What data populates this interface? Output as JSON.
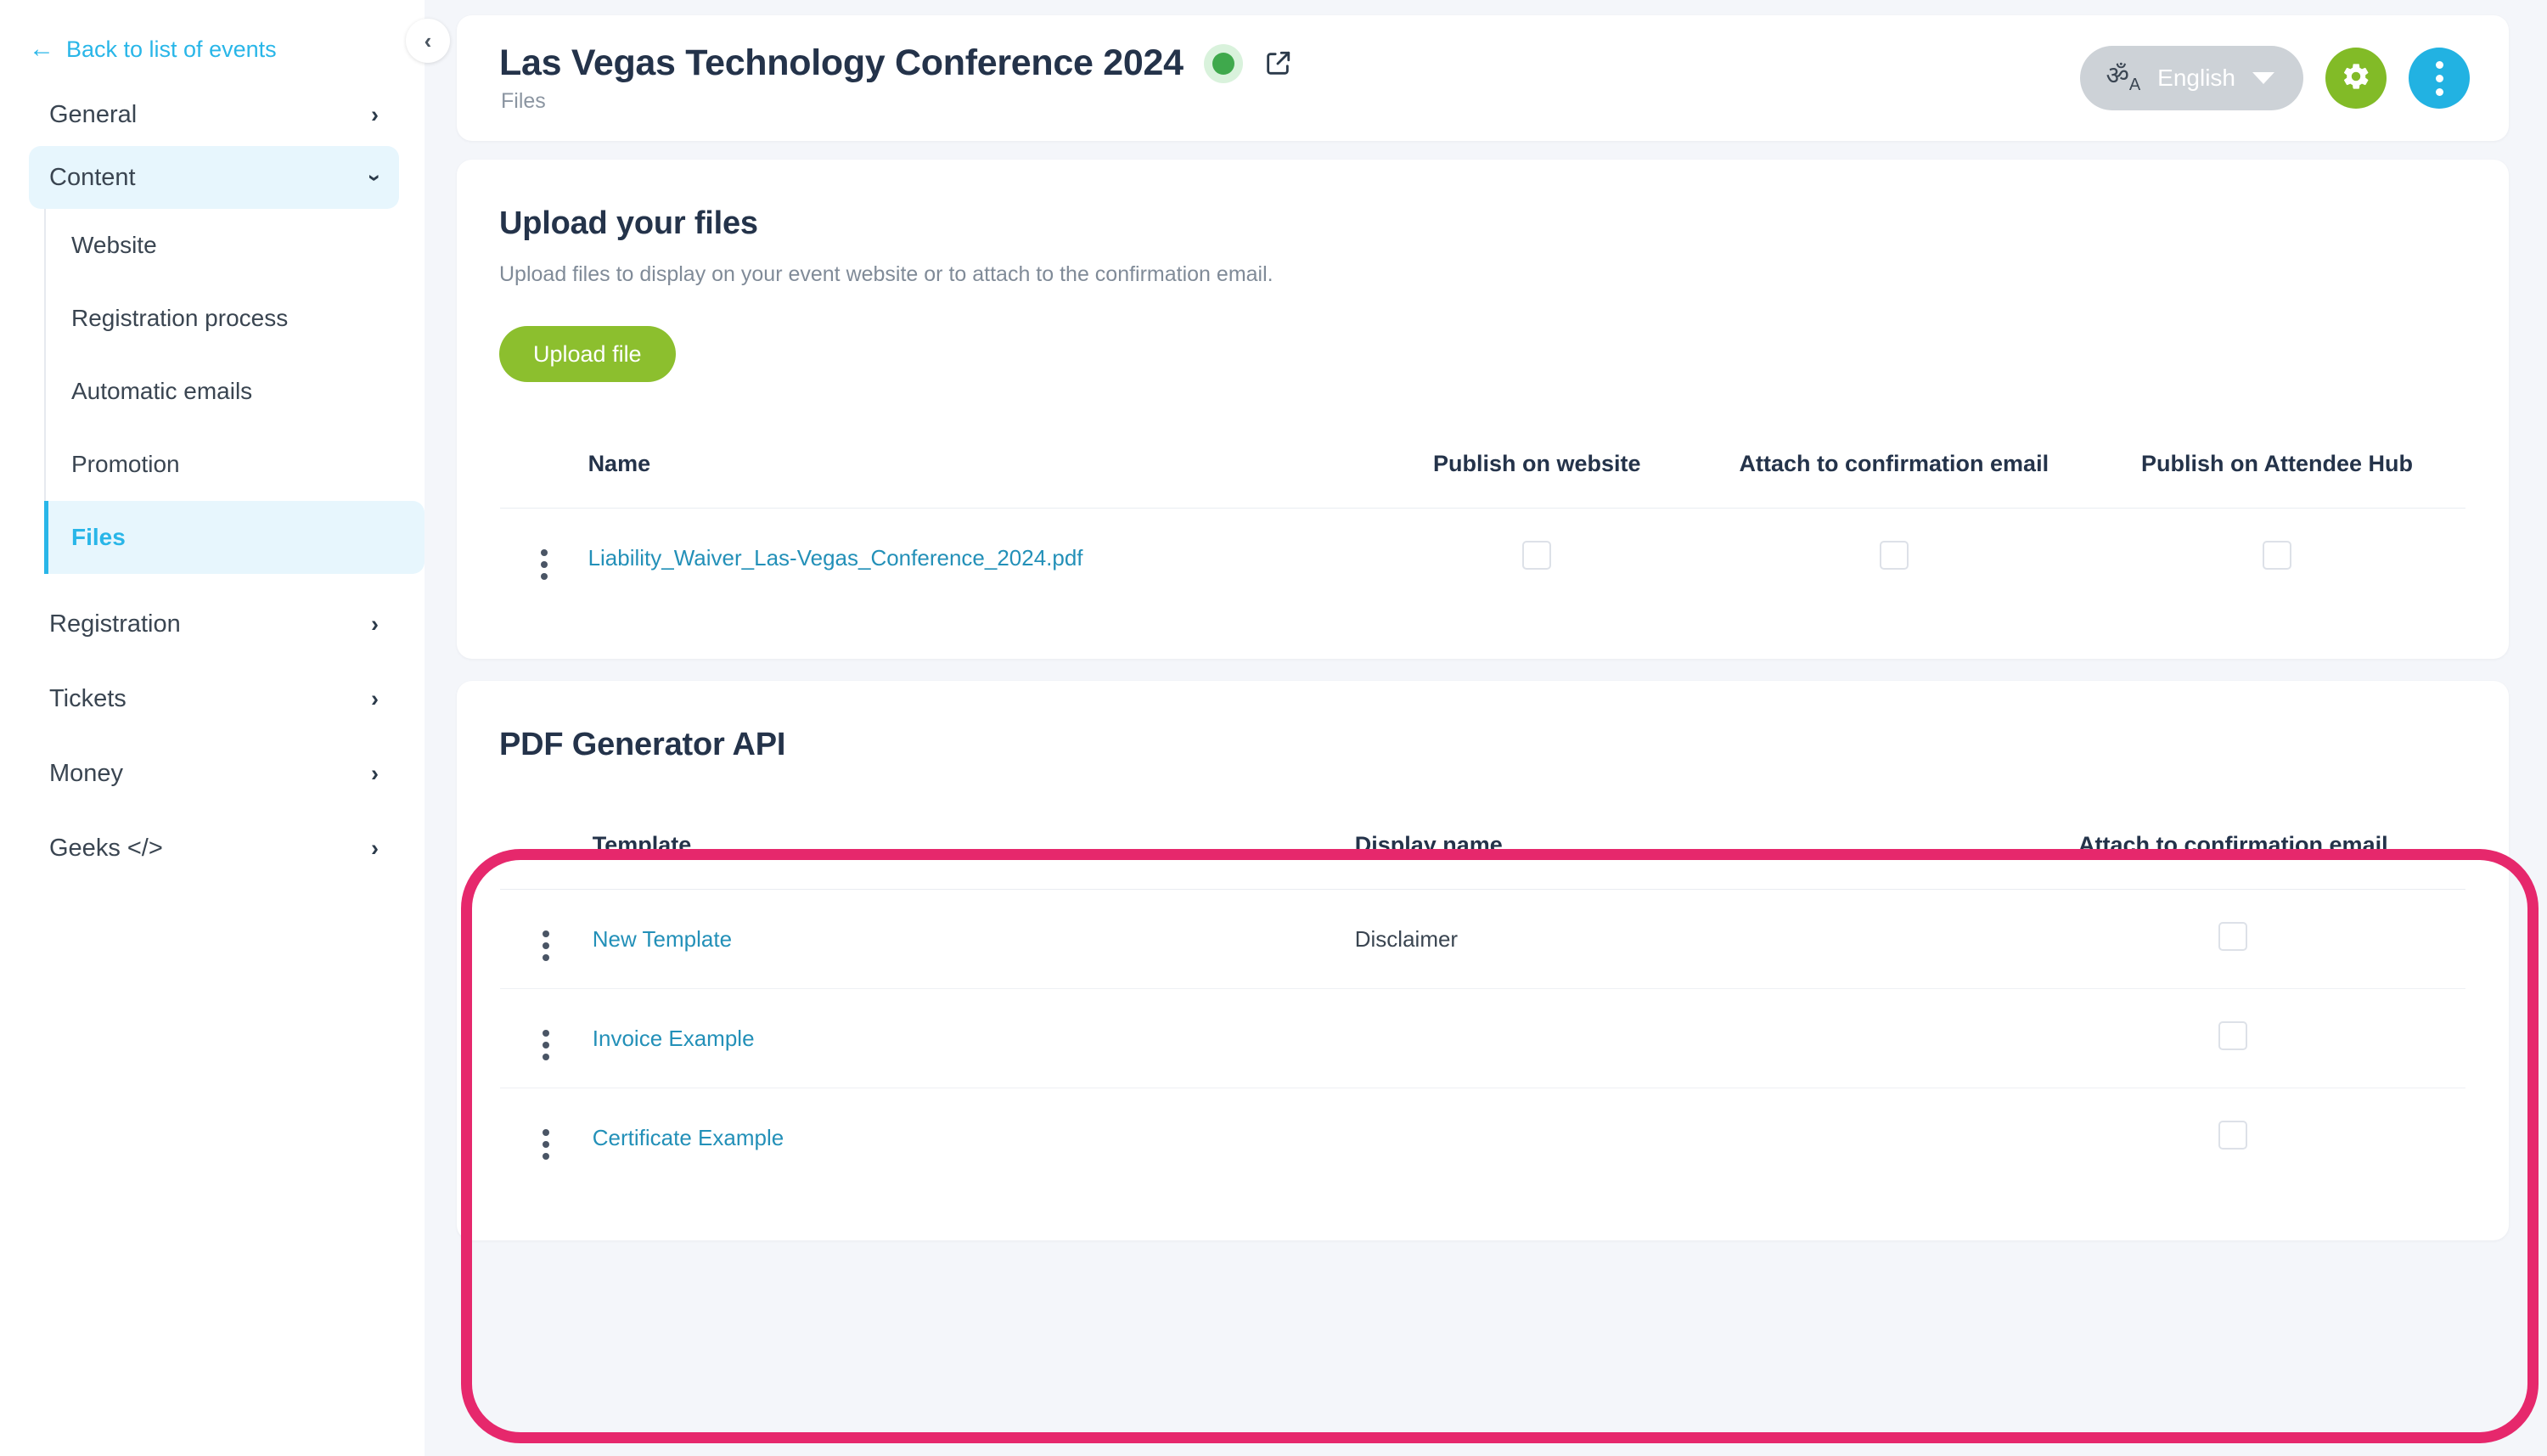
{
  "sidebar": {
    "back_link": "Back to list of events",
    "back_icon": "arrow-left-icon",
    "collapse_icon": "chevron-left-icon",
    "items": [
      {
        "label": "General",
        "chevron": "›",
        "state": "collapsed"
      },
      {
        "label": "Content",
        "chevron": "›",
        "state": "expanded"
      },
      {
        "label": "Registration",
        "chevron": "›",
        "state": "collapsed"
      },
      {
        "label": "Tickets",
        "chevron": "›",
        "state": "collapsed"
      },
      {
        "label": "Money",
        "chevron": "›",
        "state": "collapsed"
      },
      {
        "label": "Geeks </>",
        "chevron": "›",
        "state": "collapsed"
      }
    ],
    "content_subitems": [
      {
        "label": "Website",
        "active": false
      },
      {
        "label": "Registration process",
        "active": false
      },
      {
        "label": "Automatic emails",
        "active": false
      },
      {
        "label": "Promotion",
        "active": false
      },
      {
        "label": "Files",
        "active": true
      }
    ]
  },
  "header": {
    "title": "Las Vegas Technology Conference 2024",
    "subtitle": "Files",
    "status_icon": "status-dot-green",
    "external_link_icon": "external-link-icon",
    "language_icon": "translate-icon",
    "language_label": "English",
    "settings_icon": "gear-icon",
    "more_icon": "kebab-menu-icon"
  },
  "upload_section": {
    "title": "Upload your files",
    "description": "Upload files to display on your event website or to attach to the confirmation email.",
    "upload_button": "Upload file",
    "table": {
      "columns": [
        "",
        "Name",
        "Publish on website",
        "Attach to confirmation email",
        "Publish on Attendee Hub"
      ],
      "rows": [
        {
          "kebab": "row-menu-icon",
          "name": "Liability_Waiver_Las-Vegas_Conference_2024.pdf",
          "publish_on_website": false,
          "attach_to_confirmation_email": false,
          "publish_on_attendee_hub": false
        }
      ]
    }
  },
  "pdf_section": {
    "title": "PDF Generator API",
    "table": {
      "columns": [
        "",
        "Template",
        "Display name",
        "Attach to confirmation email"
      ],
      "rows": [
        {
          "kebab": "row-menu-icon",
          "template": "New Template",
          "display_name": "Disclaimer",
          "attach_to_confirmation_email": false
        },
        {
          "kebab": "row-menu-icon",
          "template": "Invoice Example",
          "display_name": "",
          "attach_to_confirmation_email": false
        },
        {
          "kebab": "row-menu-icon",
          "template": "Certificate Example",
          "display_name": "",
          "attach_to_confirmation_email": false
        }
      ]
    }
  },
  "colors": {
    "accent_blue": "#29b6e8",
    "accent_green": "#8cbf2e",
    "link_blue": "#2390b8",
    "highlight_pink": "#e6286c",
    "status_green": "#3fa94c",
    "page_bg": "#f4f6fa",
    "title_dark": "#24334a"
  }
}
